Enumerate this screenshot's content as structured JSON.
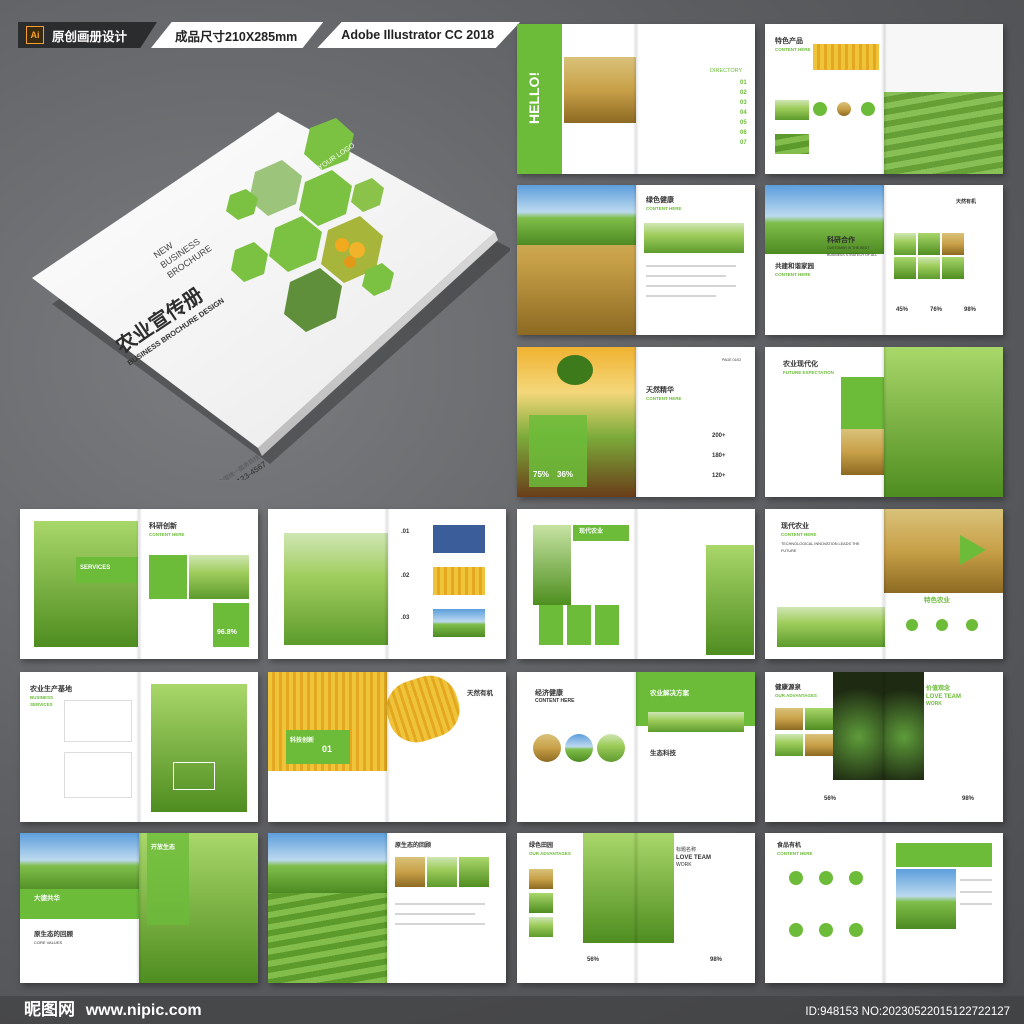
{
  "header": {
    "app_icon": "Ai",
    "item1": "原创画册设计",
    "item2": "成品尺寸210X285mm",
    "item3": "Adobe Illustrator CC 2018"
  },
  "cover": {
    "logo": "YOUR LOGO",
    "eng_line1": "NEW",
    "eng_line2": "BUSINESS",
    "eng_line3": "BROCHURE",
    "title": "农业宣传册",
    "subtitle": "BUSINESS BROCHURE DESIGN",
    "contact_label": "全国统一服务热线",
    "phone": "400-123-4567"
  },
  "pages": {
    "p1": {
      "hello": "HELLO!",
      "directory": "DIRECTORY",
      "nums": [
        "01",
        "02",
        "03",
        "04",
        "05",
        "06",
        "07"
      ]
    },
    "p2": {
      "title": "特色产品",
      "sub": "CONTENT HERE"
    },
    "p3": {
      "title": "绿色健康",
      "sub": "CONTENT HERE"
    },
    "p4": {
      "title": "科研合作",
      "sub": "CUSTOMER IS THE BEST BUSINESS STRATEGY OF ALL",
      "title2": "共建和谐家园",
      "sub2": "CONTENT HERE",
      "stats": [
        "45%",
        "76%",
        "98%"
      ],
      "tag": "天然有机"
    },
    "p5": {
      "title": "天然精华",
      "sub": "CONTENT HERE",
      "stats": [
        "75%",
        "36%"
      ],
      "nums": [
        "200+",
        "180+",
        "120+"
      ],
      "page": "PAGE 01/02"
    },
    "p6": {
      "title": "农业现代化",
      "sub": "FUTURE EXPECTATION"
    },
    "p7": {
      "title": "科研创新",
      "sub": "CONTENT HERE",
      "services": "SERVICES",
      "pct": "96.8%"
    },
    "p8": {
      "nums": [
        ".01",
        ".02",
        ".03"
      ]
    },
    "p9": {
      "title": "现代农业"
    },
    "p10": {
      "title": "现代农业",
      "sub": "CONTENT HERE",
      "line": "TECHNOLOGICAL INNOVATION LEADS THE FUTURE",
      "tag": "特色农业"
    },
    "p11": {
      "title": "农业生产基地",
      "sub": "BUSINESS SERVICES"
    },
    "p12": {
      "title": "天然有机",
      "label": "科技创新",
      "num": "01"
    },
    "p13": {
      "title": "经济健康",
      "sub": "CONTENT HERE",
      "title2": "农业解决方案",
      "title3": "生态科技"
    },
    "p14": {
      "title": "健康源泉",
      "sub": "OUR ADVANTAGES",
      "team": "LOVE TEAM",
      "work": "WORK",
      "stats": [
        "56%",
        "98%"
      ],
      "tag": "价值观念"
    },
    "p15": {
      "title": "开放生态",
      "title2": "大德共华",
      "title3": "原生态的回顾",
      "sub": "CORE VALUES"
    },
    "p16": {
      "title": "原生态的回顾"
    },
    "p17": {
      "title": "绿色田园",
      "sub": "OUR ADVANTAGES",
      "team": "LOVE TEAM",
      "work": "WORK",
      "stats": [
        "56%",
        "98%"
      ],
      "tag": "标题名称"
    },
    "p18": {
      "title": "食品有机",
      "sub": "CONTENT HERE"
    }
  },
  "footer": {
    "brand": "昵图网",
    "url": "www.nipic.com",
    "id": "ID:948153 NO:20230522015122722127"
  }
}
